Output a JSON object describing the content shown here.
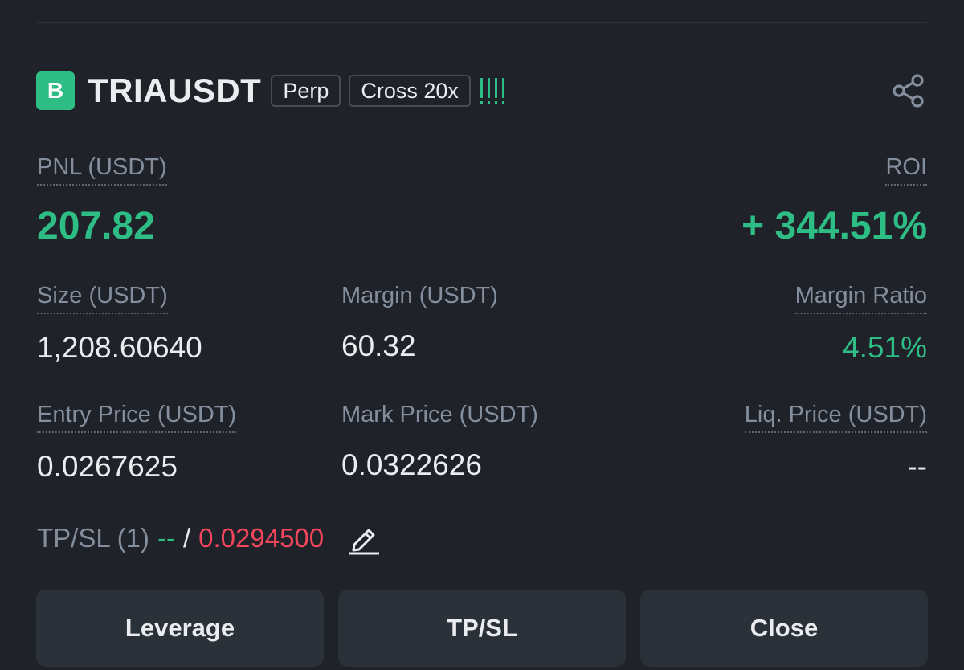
{
  "position": {
    "badge_letter": "B",
    "symbol": "TRIAUSDT",
    "type_tag": "Perp",
    "margin_tag": "Cross 20x",
    "risk_indicator_level": 4,
    "icons": {
      "share": "share-icon",
      "edit": "pencil-edit-icon"
    }
  },
  "stats": {
    "pnl_label": "PNL (USDT)",
    "pnl_value": "207.82",
    "roi_label": "ROI",
    "roi_value": "+ 344.51%",
    "size_label": "Size (USDT)",
    "size_value": "1,208.60640",
    "margin_label": "Margin (USDT)",
    "margin_value": "60.32",
    "margin_ratio_label": "Margin Ratio",
    "margin_ratio_value": "4.51%",
    "entry_label": "Entry Price (USDT)",
    "entry_value": "0.0267625",
    "mark_label": "Mark Price (USDT)",
    "mark_value": "0.0322626",
    "liq_label": "Liq. Price (USDT)",
    "liq_value": "--"
  },
  "tpsl": {
    "label": "TP/SL (1)",
    "tp_value": "--",
    "separator": "/",
    "sl_value": "0.0294500"
  },
  "actions": {
    "leverage_label": "Leverage",
    "tpsl_label": "TP/SL",
    "close_label": "Close"
  },
  "colors": {
    "background": "#1f2329",
    "positive": "#2ebd85",
    "negative": "#f6465d",
    "muted": "#848e9c",
    "button": "#2b3139"
  }
}
